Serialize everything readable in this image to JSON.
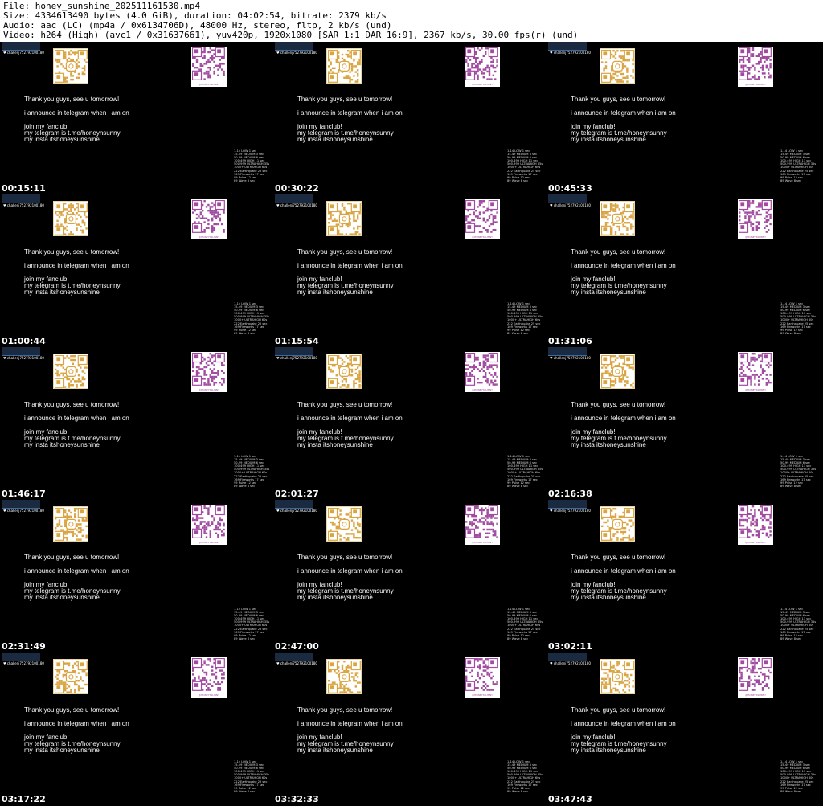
{
  "header": {
    "file": "File: honey_sunshine_202511161530.mp4",
    "size": "Size: 4334613490 bytes (4.0 GiB), duration: 04:02:54, bitrate: 2379 kb/s",
    "audio": "Audio: aac (LC) (mp4a / 0x6134706D), 48000 Hz, stereo, fltp, 2 kb/s (und)",
    "video": "Video: h264 (High) (avc1 / 0x31637661), yuv420p, 1920x1080 [SAR 1:1 DAR 16:9], 2367 kb/s, 30.00 fps(r) (und)"
  },
  "frame": {
    "channel": "♥ challenj752792100180",
    "qr_label": "@HONEYSSUNNY",
    "line1": "Thank you guys, see u tomorrow!",
    "line2": "i announce in telegram when i am on",
    "line3": "join my fanclub!",
    "line4": "my telegram is t.me/honeynsunny",
    "line5": "my insta itshoneysunshine",
    "schedule": [
      "1-14 LOW 1 sec",
      "15-49 MEDIUM 3 sec",
      "50-99 MEDIUM 6 sec",
      "100-499 HIGH 11 sec",
      "500-999 ULTRAHIGH 35s",
      "1000+ ULTRAHIGH 60s",
      "222 Earthquake 25 sec",
      "169 Fireworks 17 sec",
      "99 Pulse 12 sec",
      "89 Wave 8 sec"
    ],
    "icons": [
      "instagram-qr-icon",
      "telegram-qr-icon"
    ],
    "colors": {
      "qr_left": "#d9a441",
      "qr_right": "#a04aa0",
      "bar": "#3a6aa0"
    }
  },
  "timestamps": [
    "00:15:11",
    "00:30:22",
    "00:45:33",
    "01:00:44",
    "01:15:54",
    "01:31:06",
    "01:46:17",
    "02:01:27",
    "02:16:38",
    "02:31:49",
    "02:47:00",
    "03:02:11",
    "03:17:22",
    "03:32:33",
    "03:47:43"
  ]
}
